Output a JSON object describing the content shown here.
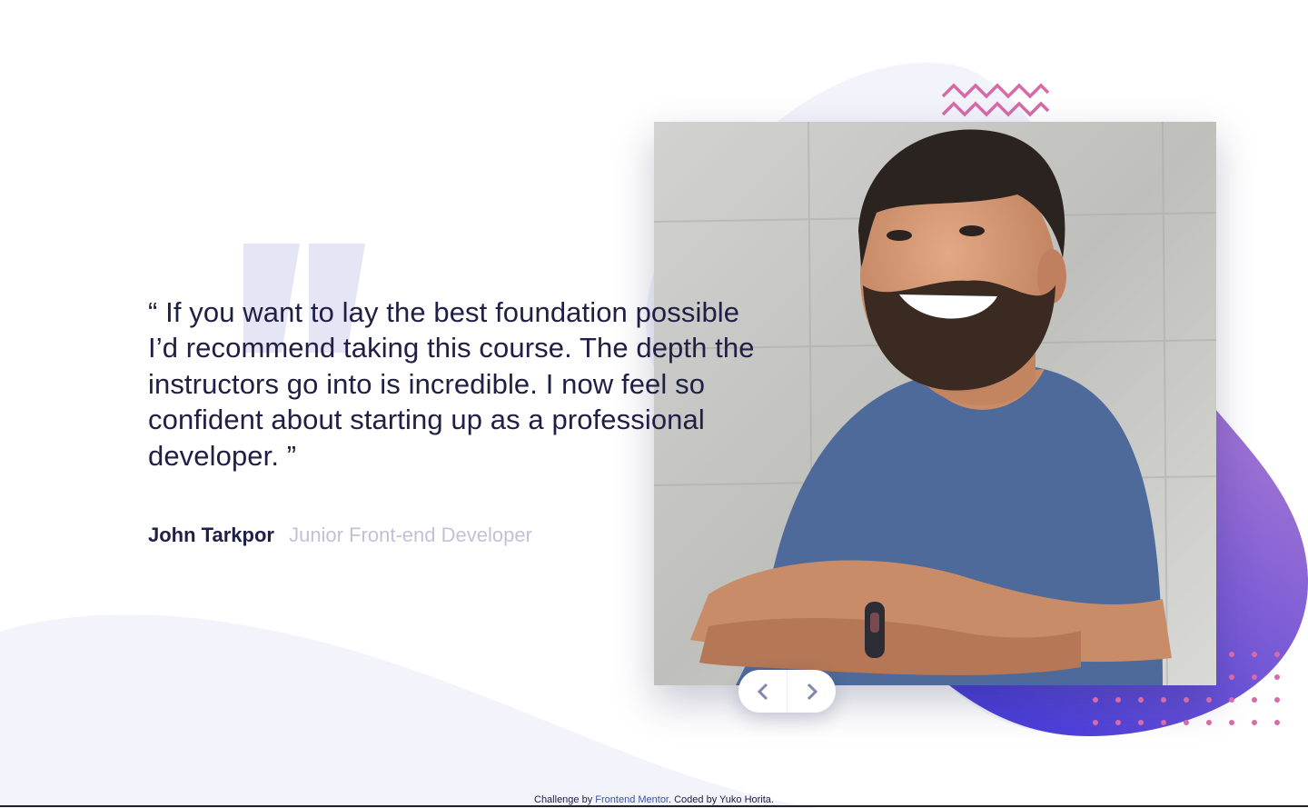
{
  "testimonial": {
    "quote": "“ If you want to lay the best foundation possible I’d recommend taking this course. The depth the instructors go into is incredible. I now feel so confident about starting up as a professional developer. ”",
    "author_name": "John Tarkpor",
    "author_role": "Junior Front-end Developer",
    "photo_alt": "John Tarkpor"
  },
  "navigation": {
    "prev_icon": "chevron-left-icon",
    "next_icon": "chevron-right-icon"
  },
  "footer": {
    "prefix": "Challenge by ",
    "link_text": "Frontend Mentor",
    "suffix": ". Coded by Yuko Horita."
  },
  "colors": {
    "text_dark": "#202046",
    "text_muted": "#c2c1d8",
    "accent_purple": "#6651d8",
    "accent_pink": "#d86aa8",
    "background_tint": "#f3f3fc",
    "link": "#3e52a3"
  }
}
